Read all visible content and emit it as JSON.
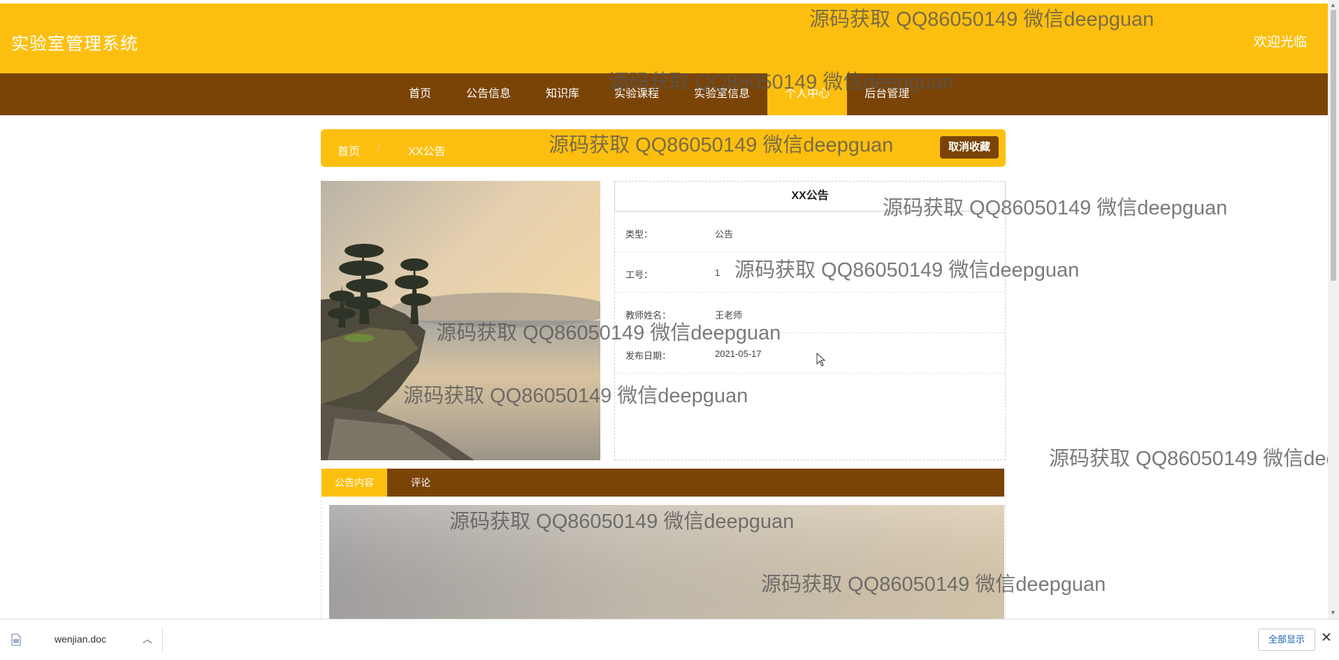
{
  "header": {
    "title": "实验室管理系统",
    "welcome": "欢迎光临"
  },
  "nav": {
    "items": [
      {
        "label": "首页"
      },
      {
        "label": "公告信息"
      },
      {
        "label": "知识库"
      },
      {
        "label": "实验课程"
      },
      {
        "label": "实验室信息"
      },
      {
        "label": "个人中心",
        "active": true
      },
      {
        "label": "后台管理"
      }
    ]
  },
  "breadcrumb": {
    "home": "首页",
    "separator": "/",
    "current": "XX公告",
    "unfavorite_label": "取消收藏"
  },
  "detail": {
    "title": "XX公告",
    "fields": [
      {
        "label": "类型：",
        "value": "公告"
      },
      {
        "label": "工号：",
        "value": "1"
      },
      {
        "label": "教师姓名：",
        "value": "王老师"
      },
      {
        "label": "发布日期：",
        "value": "2021-05-17"
      }
    ]
  },
  "tabs": [
    {
      "label": "公告内容",
      "active": true
    },
    {
      "label": "评论"
    }
  ],
  "watermark": "源码获取 QQ86050149 微信deepguan",
  "download": {
    "file_name": "wenjian.doc",
    "show_all": "全部显示"
  },
  "colors": {
    "primary": "#fdbf0f",
    "dark": "#7a4407"
  }
}
